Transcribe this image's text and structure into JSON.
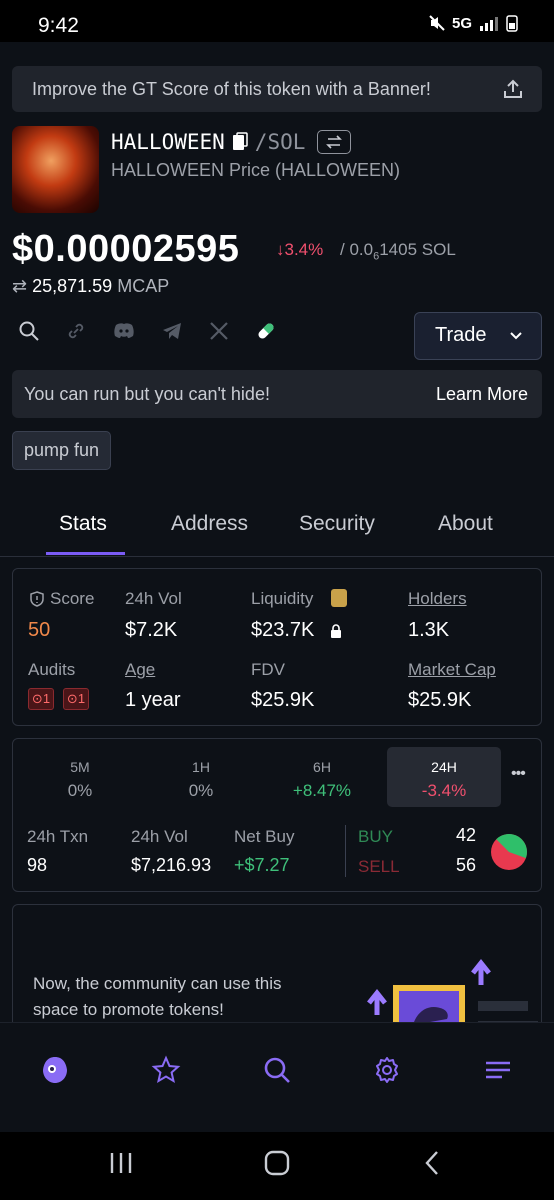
{
  "status_bar": {
    "time": "9:42",
    "network": "5G"
  },
  "banner": {
    "text": "Improve the GT Score of this token with a Banner!"
  },
  "token": {
    "symbol": "HALLOWEEN",
    "pair": "/SOL",
    "subtitle": "HALLOWEEN Price (HALLOWEEN)",
    "price": "$0.00002595",
    "change": "↓3.4%",
    "sol_price_prefix": "/ 0.0",
    "sol_price_sub": "6",
    "sol_price_suffix": "1405 SOL",
    "mcap_value": "25,871.59",
    "mcap_label": "MCAP"
  },
  "trade_button": {
    "label": "Trade"
  },
  "promo": {
    "text": "You can run but you can't hide!",
    "link": "Learn More"
  },
  "tag": "pump fun",
  "tabs": [
    "Stats",
    "Address",
    "Security",
    "About"
  ],
  "stats": {
    "score_label": "Score",
    "score_value": "50",
    "vol_label": "24h Vol",
    "vol_value": "$7.2K",
    "liq_label": "Liquidity",
    "liq_value": "$23.7K",
    "holders_label": "Holders",
    "holders_value": "1.3K",
    "audits_label": "Audits",
    "audit_1": "1",
    "audit_2": "1",
    "age_label": "Age",
    "age_value": "1 year",
    "fdv_label": "FDV",
    "fdv_value": "$25.9K",
    "mcap_label": "Market Cap",
    "mcap_value": "$25.9K"
  },
  "timeframes": [
    {
      "label": "5M",
      "value": "0%"
    },
    {
      "label": "1H",
      "value": "0%"
    },
    {
      "label": "6H",
      "value": "+8.47%"
    },
    {
      "label": "24H",
      "value": "-3.4%"
    }
  ],
  "txn": {
    "txn_label": "24h Txn",
    "txn_value": "98",
    "vol_label": "24h Vol",
    "vol_value": "$7,216.93",
    "net_label": "Net Buy",
    "net_value": "+$7.27",
    "buy_label": "BUY",
    "buy_value": "42",
    "sell_label": "SELL",
    "sell_value": "56",
    "buy_fraction": 0.43
  },
  "community": {
    "text_line1": "Now, the community can use this",
    "text_line2": "space to promote tokens!"
  },
  "colors": {
    "accent": "#7b5cf5",
    "positive": "#3fc07a",
    "negative": "#f0506e",
    "score": "#f0884a"
  }
}
